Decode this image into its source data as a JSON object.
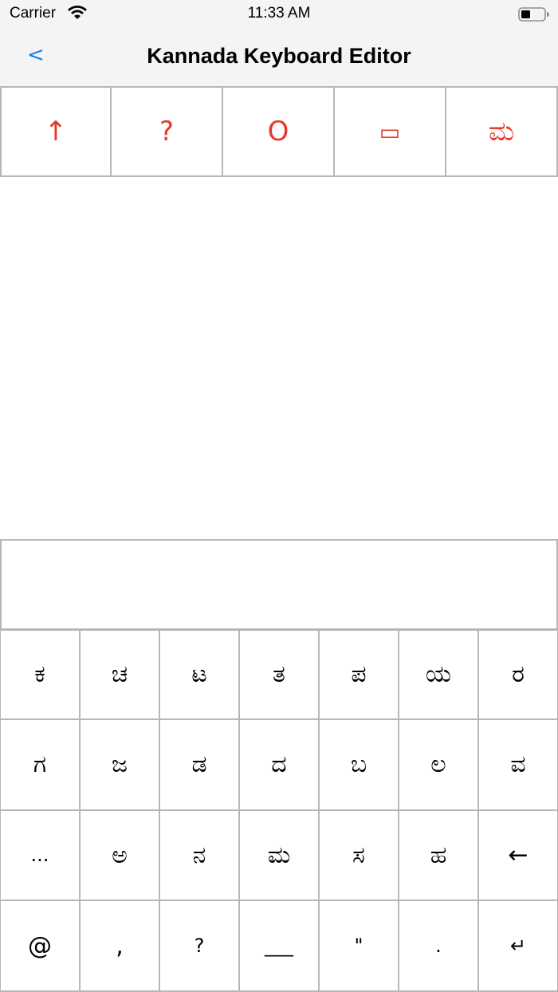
{
  "status_bar": {
    "carrier": "Carrier",
    "time": "11:33 AM"
  },
  "nav": {
    "back_label": "<",
    "title": "Kannada Keyboard Editor"
  },
  "suggestions": [
    "↑",
    "?",
    "O",
    "▭",
    "ಮ"
  ],
  "editor": {
    "value": ""
  },
  "keyboard": {
    "rows": [
      [
        "ಕ",
        "ಚ",
        "ಟ",
        "ತ",
        "ಪ",
        "ಯ",
        "ರ"
      ],
      [
        "ಗ",
        "ಜ",
        "ಡ",
        "ದ",
        "ಬ",
        "ಲ",
        "ವ"
      ],
      [
        "...",
        "ಅ",
        "ನ",
        "ಮ",
        "ಸ",
        "ಹ",
        "←"
      ],
      [
        "@",
        ",",
        "?",
        "___",
        "\"",
        ".",
        "↵"
      ]
    ]
  },
  "colors": {
    "accent": "#1a7cf5",
    "suggestion_text": "#e6392b",
    "grid_line": "#b7b7b7"
  }
}
